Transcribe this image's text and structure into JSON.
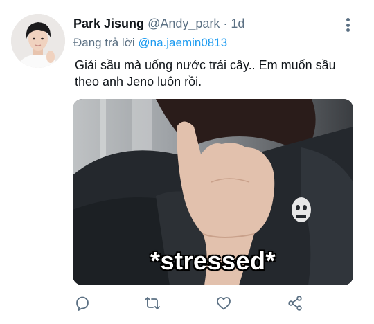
{
  "tweet": {
    "author_name": "Park Jisung",
    "author_handle": "@Andy_park",
    "separator": "·",
    "time": "1d",
    "reply_prefix": "Đang trả lời",
    "reply_to": "@na.jaemin0813",
    "text": "Giải sầu mà uống nước trái cây.. Em muốn sầu theo anh Jeno luôn rồi.",
    "media_caption": "*stressed*"
  },
  "actions": {
    "icons": [
      "reply-icon",
      "retweet-icon",
      "like-icon",
      "share-icon"
    ]
  },
  "colors": {
    "accent": "#1d9bf0",
    "secondary_text": "#5b7083",
    "primary_text": "#0f1419"
  }
}
